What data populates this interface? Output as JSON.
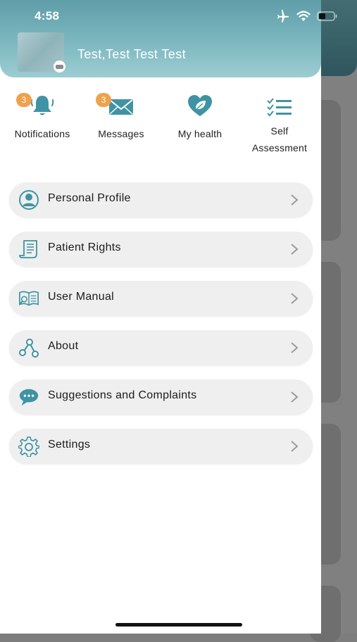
{
  "status_bar": {
    "time": "4:58",
    "icons": [
      "airplane-icon",
      "wifi-icon",
      "battery-icon"
    ]
  },
  "profile": {
    "name": "Test,Test Test Test"
  },
  "quick_actions": [
    {
      "label": "Notifications",
      "badge": "3",
      "icon": "bell-icon"
    },
    {
      "label": "Messages",
      "badge": "3",
      "icon": "envelope-icon"
    },
    {
      "label": "My health",
      "icon": "heart-leaf-icon"
    },
    {
      "label_line1": "Self",
      "label_line2": "Assessment",
      "icon": "checklist-icon"
    }
  ],
  "menu": [
    {
      "label": "Personal Profile",
      "icon": "person-icon"
    },
    {
      "label": "Patient Rights",
      "icon": "scroll-icon"
    },
    {
      "label": "User Manual",
      "icon": "book-icon"
    },
    {
      "label": "About",
      "icon": "share-nodes-icon"
    },
    {
      "label": "Suggestions and Complaints",
      "icon": "chat-bubble-icon"
    },
    {
      "label": "Settings",
      "icon": "gear-icon"
    }
  ],
  "colors": {
    "accent": "#3f93a3",
    "header_top": "#5f9da8",
    "header_bottom": "#9ccdd2",
    "badge": "#f0a14b",
    "menu_bg": "#efefef"
  }
}
